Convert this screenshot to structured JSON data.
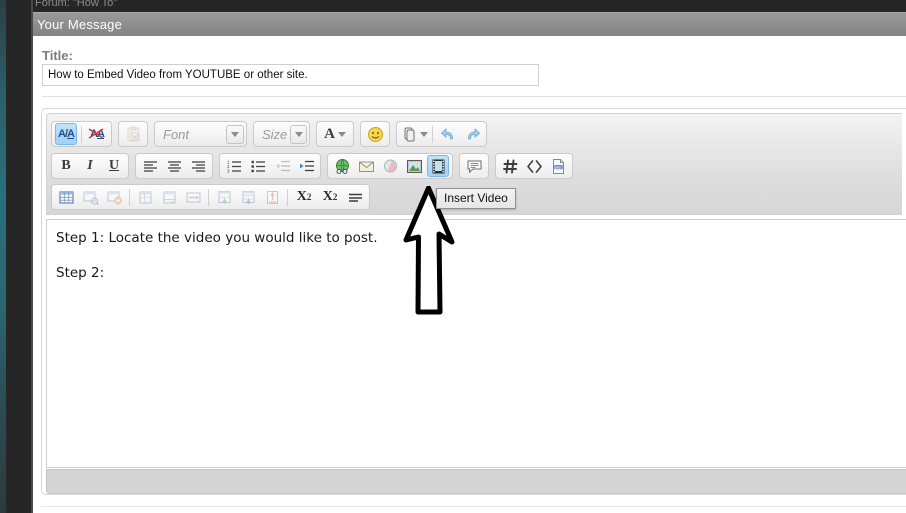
{
  "window": {
    "forum_breadcrumb": "Forum: \"How To\"",
    "panel_header": "Your Message"
  },
  "title_field": {
    "label": "Title:",
    "value": "How to Embed Video from YOUTUBE or other site.",
    "placeholder": "Title"
  },
  "editor": {
    "font_select": {
      "label": "Font",
      "value": ""
    },
    "size_select": {
      "label": "Size",
      "value": ""
    },
    "toolbar_rows": [
      {
        "groups": [
          {
            "buttons": [
              {
                "name": "spellcheck-toggle-icon",
                "label": "A/A",
                "state": "active"
              },
              {
                "name": "spellcheck-off-icon",
                "label": "A/A",
                "state": "normal"
              }
            ]
          },
          {
            "buttons": [
              {
                "name": "paste-from-word-icon",
                "label": "Paste from Word",
                "state": "disabled"
              }
            ]
          }
        ]
      },
      {
        "groups": [
          {
            "buttons": [
              {
                "name": "bold-button",
                "label": "B",
                "state": "normal"
              },
              {
                "name": "italic-button",
                "label": "I",
                "state": "normal"
              },
              {
                "name": "underline-button",
                "label": "U",
                "state": "normal"
              }
            ]
          },
          {
            "buttons": [
              {
                "name": "align-left-button",
                "label": "Align Left",
                "state": "normal"
              },
              {
                "name": "align-center-button",
                "label": "Align Center",
                "state": "normal"
              },
              {
                "name": "align-right-button",
                "label": "Align Right",
                "state": "normal"
              }
            ]
          },
          {
            "buttons": [
              {
                "name": "ordered-list-button",
                "label": "Numbered List",
                "state": "normal"
              },
              {
                "name": "unordered-list-button",
                "label": "Bullet List",
                "state": "normal"
              },
              {
                "name": "outdent-button",
                "label": "Decrease Indent",
                "state": "disabled"
              },
              {
                "name": "indent-button",
                "label": "Increase Indent",
                "state": "normal"
              }
            ]
          },
          {
            "buttons": [
              {
                "name": "insert-link-icon",
                "label": "Insert Link",
                "state": "normal"
              },
              {
                "name": "insert-email-icon",
                "label": "Insert Email",
                "state": "normal"
              },
              {
                "name": "remove-link-icon",
                "label": "Remove Link",
                "state": "normal"
              },
              {
                "name": "insert-image-icon",
                "label": "Insert Image",
                "state": "normal"
              },
              {
                "name": "insert-video-icon",
                "label": "Insert Video",
                "state": "active"
              }
            ]
          },
          {
            "buttons": [
              {
                "name": "insert-quote-icon",
                "label": "Insert Quote",
                "state": "normal"
              }
            ]
          },
          {
            "buttons": [
              {
                "name": "insert-code-icon",
                "label": "Insert Code",
                "state": "normal"
              },
              {
                "name": "insert-html-icon",
                "label": "Insert HTML",
                "state": "normal"
              },
              {
                "name": "insert-php-icon",
                "label": "Insert PHP",
                "state": "normal"
              }
            ]
          }
        ]
      },
      {
        "groups": [
          {
            "buttons": [
              {
                "name": "insert-table-icon",
                "label": "Insert Table",
                "state": "normal"
              },
              {
                "name": "table-properties-icon",
                "label": "Table Properties",
                "state": "disabled"
              },
              {
                "name": "delete-table-icon",
                "label": "Delete Table",
                "state": "disabled"
              },
              {
                "name": "insert-row-icon",
                "label": "Insert Row",
                "state": "disabled"
              },
              {
                "name": "insert-column-icon",
                "label": "Insert Column",
                "state": "disabled"
              },
              {
                "name": "merge-cells-icon",
                "label": "Merge Cells",
                "state": "disabled"
              },
              {
                "name": "insert-cell-before-icon",
                "label": "Insert Cell Before",
                "state": "disabled"
              },
              {
                "name": "insert-cell-after-icon",
                "label": "Insert Cell After",
                "state": "disabled"
              },
              {
                "name": "delete-cell-icon",
                "label": "Delete Cell",
                "state": "disabled"
              },
              {
                "name": "subscript-button",
                "label": "X2",
                "state": "normal"
              },
              {
                "name": "superscript-button",
                "label": "X2",
                "state": "normal"
              },
              {
                "name": "horizontal-rule-button",
                "label": "Horizontal Rule",
                "state": "normal"
              }
            ]
          }
        ]
      }
    ],
    "text_color_label": "A",
    "emoticon_label": "Insert Emoticon",
    "attachment_label": "Attach File",
    "undo_label": "Undo",
    "redo_label": "Redo",
    "subscript_base": "X",
    "subscript_exp": "2",
    "superscript_base": "X",
    "superscript_exp": "2",
    "content_lines": [
      "Step 1: Locate the video you would like to post.",
      "",
      "Step 2:"
    ]
  },
  "tooltip": {
    "text": "Insert Video"
  },
  "annotation": {
    "type": "hand-drawn-arrow",
    "direction": "up",
    "points_at": "insert-video-icon",
    "color": "#000000"
  },
  "colors": {
    "header_bar": "#8e8e8e",
    "chrome_dark": "#262626",
    "gutter_teal": "#29707c",
    "toolbar_bg": "#dedede",
    "active_button": "#9ed2f6",
    "status_bar": "#d4d4d4"
  }
}
